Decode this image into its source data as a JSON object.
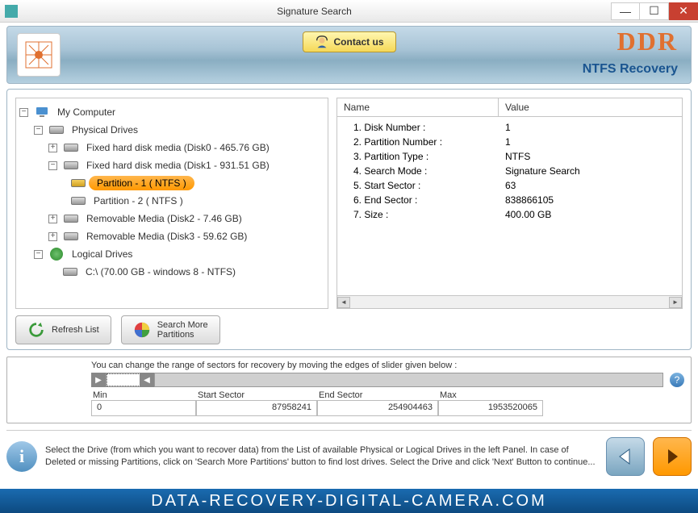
{
  "window": {
    "title": "Signature Search"
  },
  "header": {
    "contact_label": "Contact us",
    "brand": "DDR",
    "product": "NTFS Recovery"
  },
  "tree": {
    "root": "My Computer",
    "physical": "Physical Drives",
    "disk0": "Fixed hard disk media (Disk0 - 465.76 GB)",
    "disk1": "Fixed hard disk media (Disk1 - 931.51 GB)",
    "part1": "Partition - 1 ( NTFS )",
    "part2": "Partition - 2 ( NTFS )",
    "disk2": "Removable Media (Disk2 - 7.46 GB)",
    "disk3": "Removable Media (Disk3 - 59.62 GB)",
    "logical": "Logical Drives",
    "c_drive": "C:\\ (70.00 GB - windows 8 - NTFS)"
  },
  "info": {
    "header_name": "Name",
    "header_value": "Value",
    "rows": [
      {
        "name": "1. Disk Number :",
        "value": "1"
      },
      {
        "name": "2. Partition Number :",
        "value": "1"
      },
      {
        "name": "3. Partition Type :",
        "value": "NTFS"
      },
      {
        "name": "4. Search Mode :",
        "value": "Signature Search"
      },
      {
        "name": "5. Start Sector :",
        "value": "63"
      },
      {
        "name": "6. End Sector :",
        "value": "838866105"
      },
      {
        "name": "7. Size :",
        "value": "400.00 GB"
      }
    ]
  },
  "buttons": {
    "refresh": "Refresh List",
    "search_more": "Search More\nPartitions"
  },
  "sector": {
    "hint": "You can change the range of sectors for recovery by moving the edges of slider given below :",
    "min_label": "Min",
    "min_val": "0",
    "start_label": "Start Sector",
    "start_val": "87958241",
    "end_label": "End Sector",
    "end_val": "254904463",
    "max_label": "Max",
    "max_val": "1953520065"
  },
  "help_text": "Select the Drive (from which you want to recover data) from the List of available Physical or Logical Drives in the left Panel. In case of Deleted or missing Partitions, click on 'Search More Partitions' button to find lost drives. Select the Drive and click 'Next' Button to continue...",
  "footer_brand": "DATA-RECOVERY-DIGITAL-CAMERA.COM"
}
